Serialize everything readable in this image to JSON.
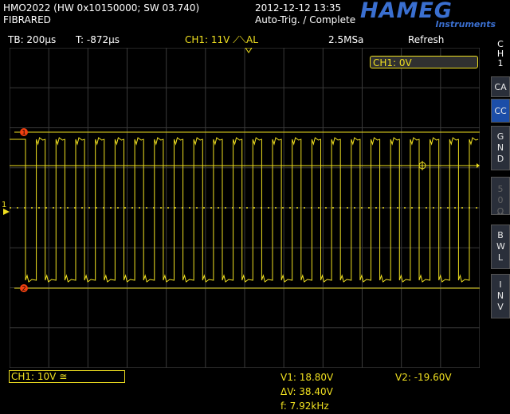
{
  "header": {
    "model": "HMO2022 (HW 0x10150000; SW 03.740)",
    "label": "FIBRARED",
    "datetime": "2012-12-12 13:35",
    "trigger_status": "Auto-Trig. / Complete",
    "logo": "HAMEG",
    "logo_sub": "Instruments"
  },
  "status_bar": {
    "timebase": "TB: 200µs",
    "time_offset": "T: -872µs",
    "channel_trigger": "CH1: 11V ⟋⟍AL",
    "sample_rate": "2.5MSa",
    "mode": "Refresh"
  },
  "scope": {
    "ch1_offset_label": "CH1: 0V",
    "marker_ch1": "1",
    "cursor1_marker": "1",
    "cursor2_marker": "2"
  },
  "side_panel": {
    "channel": [
      "C",
      "H",
      "1"
    ],
    "buttons": [
      {
        "label": "CA",
        "active": false,
        "dim": false
      },
      {
        "label": "CC",
        "active": true,
        "dim": false
      },
      {
        "label": "GND",
        "active": false,
        "dim": false
      },
      {
        "label": "50Ω",
        "active": false,
        "dim": true
      },
      {
        "label": "BWL",
        "active": false,
        "dim": false
      },
      {
        "label": "INV",
        "active": false,
        "dim": false
      }
    ]
  },
  "bottom": {
    "ch1_scale": "CH1: 10V ≅",
    "v1": "V1: 18.80V",
    "v2": "V2: -19.60V",
    "delta_v": "ΔV: 38.40V",
    "freq": "f: 7.92kHz"
  },
  "colors": {
    "trace": "#f0e020",
    "grid": "#3a3a3a",
    "accent": "#1c4ea8"
  }
}
